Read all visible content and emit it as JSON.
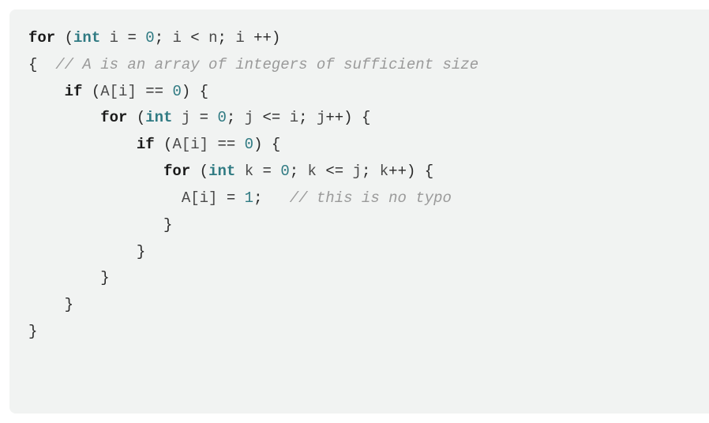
{
  "code": {
    "l1": {
      "kw_for": "for",
      "op1": " (",
      "type_int": "int",
      "sp1": " ",
      "id_i": "i",
      "eq": " = ",
      "num0": "0",
      "semi1": ";",
      "sp2": " ",
      "id_i2": "i",
      "lt": " < ",
      "id_n": "n",
      "semi2": ";",
      "sp3": " ",
      "id_i3": "i",
      "pp": " ++",
      "close": ")"
    },
    "l2": {
      "open": "{  ",
      "comment": "// A is an array of integers of sufficient size"
    },
    "l3": {
      "indent": "    ",
      "kw_if": "if",
      "op1": " (",
      "arr": "A[i]",
      "eqeq": " == ",
      "num0": "0",
      "close": ") {"
    },
    "l4": {
      "indent": "        ",
      "kw_for": "for",
      "op1": " (",
      "type_int": "int",
      "sp1": " ",
      "id_j": "j",
      "eq": " = ",
      "num0": "0",
      "semi1": ";",
      "sp2": " ",
      "id_j2": "j",
      "le": " <= ",
      "id_i": "i",
      "semi2": ";",
      "sp3": " ",
      "id_j3": "j",
      "pp": "++",
      "close": ") {"
    },
    "l5": {
      "indent": "            ",
      "kw_if": "if",
      "op1": " (",
      "arr": "A[i]",
      "eqeq": " == ",
      "num0": "0",
      "close": ") {"
    },
    "l6": {
      "indent": "               ",
      "kw_for": "for",
      "op1": " (",
      "type_int": "int",
      "sp1": " ",
      "id_k": "k",
      "eq": " = ",
      "num0": "0",
      "semi1": ";",
      "sp2": " ",
      "id_k2": "k",
      "le": " <= ",
      "id_j": "j",
      "semi2": ";",
      "sp3": " ",
      "id_k3": "k",
      "pp": "++",
      "close": ") {"
    },
    "l7": {
      "indent": "                 ",
      "arr": "A[i]",
      "eq": " = ",
      "num1": "1",
      "semi": ";",
      "gap": "   ",
      "comment": "// this is no typo"
    },
    "l8": {
      "indent": "               ",
      "close": "}"
    },
    "l9": {
      "indent": "            ",
      "close": "}"
    },
    "l10": {
      "indent": "        ",
      "close": "}"
    },
    "l11": {
      "indent": "    ",
      "close": "}"
    },
    "l12": {
      "close": "}"
    }
  }
}
